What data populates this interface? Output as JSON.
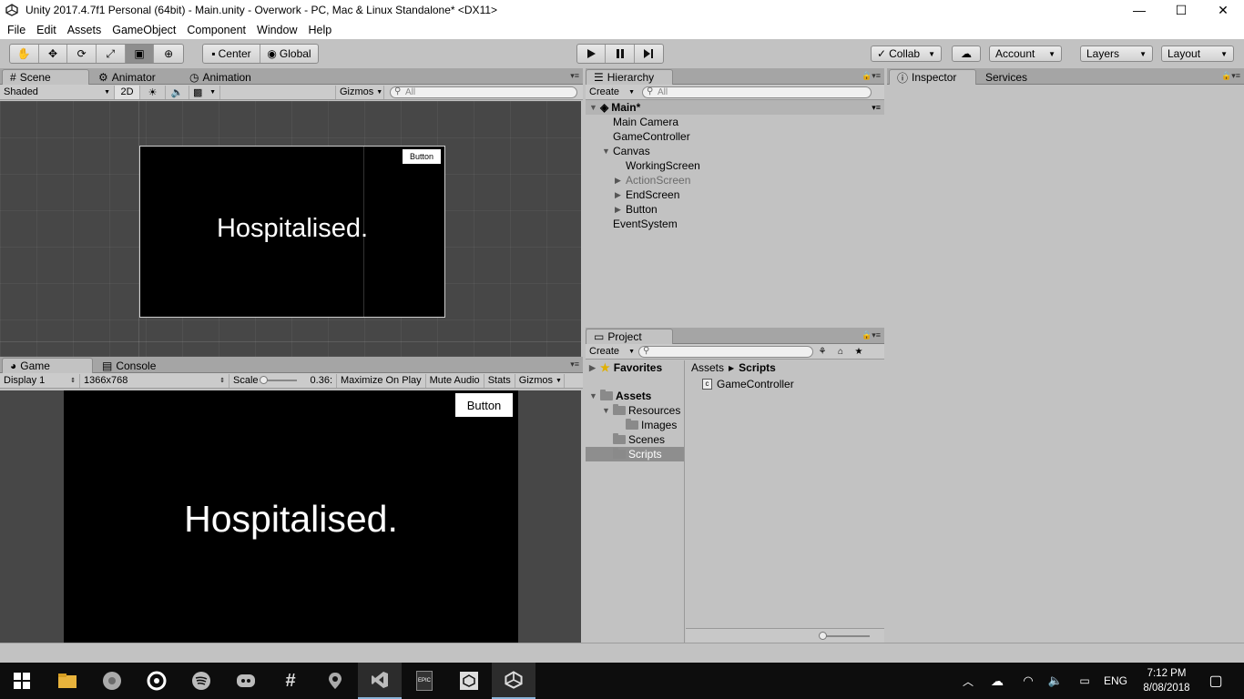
{
  "window": {
    "title": "Unity 2017.4.7f1 Personal (64bit) - Main.unity - Overwork - PC, Mac & Linux Standalone* <DX11>",
    "minimize": "—",
    "maximize": "☐",
    "close": "✕"
  },
  "menu": [
    "File",
    "Edit",
    "Assets",
    "GameObject",
    "Component",
    "Window",
    "Help"
  ],
  "toolbar": {
    "center": "Center",
    "global": "Global",
    "collab": "Collab",
    "account": "Account",
    "layers": "Layers",
    "layout": "Layout"
  },
  "scene_panel": {
    "tabs": [
      "Scene",
      "Animator",
      "Animation"
    ],
    "shading": "Shaded",
    "mode_2d": "2D",
    "gizmos": "Gizmos",
    "search_placeholder": "All",
    "canvas_text": "Hospitalised.",
    "canvas_button": "Button"
  },
  "game_panel": {
    "tabs": [
      "Game",
      "Console"
    ],
    "display": "Display 1",
    "resolution": "1366x768",
    "scale_label": "Scale",
    "scale_value": "0.36:",
    "scale_fraction": 0.05,
    "maximize": "Maximize On Play",
    "mute": "Mute Audio",
    "stats": "Stats",
    "gizmos": "Gizmos",
    "canvas_text": "Hospitalised.",
    "canvas_button": "Button"
  },
  "hierarchy": {
    "tab": "Hierarchy",
    "create": "Create",
    "search_placeholder": "All",
    "scene": "Main*",
    "items": [
      "Main Camera",
      "GameController",
      "Canvas",
      "WorkingScreen",
      "ActionScreen",
      "EndScreen",
      "Button",
      "EventSystem"
    ]
  },
  "project": {
    "tab": "Project",
    "create": "Create",
    "favorites": "Favorites",
    "assets": "Assets",
    "folders": [
      "Resources",
      "Images",
      "Scenes",
      "Scripts"
    ],
    "breadcrumb": [
      "Assets",
      "Scripts"
    ],
    "files": [
      "GameController"
    ]
  },
  "inspector": {
    "tabs": [
      "Inspector",
      "Services"
    ]
  },
  "tray": {
    "lang": "ENG",
    "time": "7:12 PM",
    "date": "8/08/2018"
  },
  "taskbar_icons": [
    "windows-start-icon",
    "file-explorer-icon",
    "chrome-icon",
    "origin-icon",
    "spotify-icon",
    "discord-icon",
    "slack-icon",
    "maps-icon",
    "visual-studio-icon",
    "epic-games-icon",
    "unity-hub-icon",
    "unity-editor-icon"
  ],
  "colors": {
    "panel": "#c2c2c2",
    "selection": "#8ea6c6",
    "viewport": "#474747",
    "taskbar": "#0d0d0d"
  }
}
